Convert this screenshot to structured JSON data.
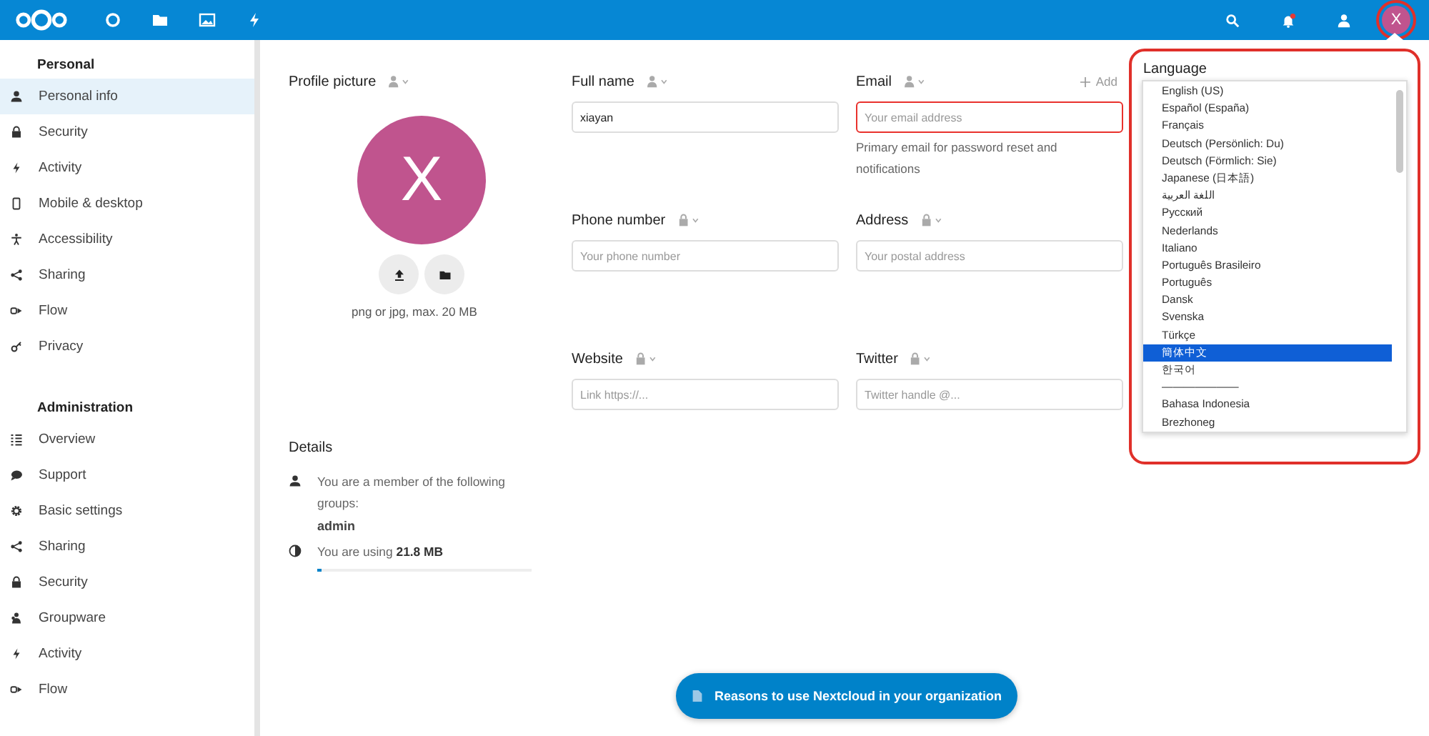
{
  "header": {
    "apps": [
      {
        "kind": "dashboard",
        "selected": false
      },
      {
        "kind": "files",
        "selected": false
      },
      {
        "kind": "photos",
        "selected": false
      },
      {
        "kind": "activity",
        "selected": false
      }
    ],
    "notifications": {
      "unread": true
    },
    "avatar": {
      "initial": "X",
      "color": "#c0548e"
    }
  },
  "sidebar": {
    "sections": [
      {
        "title": "Personal",
        "items": [
          {
            "label": "Personal info",
            "kind": "person",
            "selected": true
          },
          {
            "label": "Security",
            "kind": "lock",
            "selected": false
          },
          {
            "label": "Activity",
            "kind": "bolt",
            "selected": false
          },
          {
            "label": "Mobile & desktop",
            "kind": "phone",
            "selected": false
          },
          {
            "label": "Accessibility",
            "kind": "access",
            "selected": false
          },
          {
            "label": "Sharing",
            "kind": "share",
            "selected": false
          },
          {
            "label": "Flow",
            "kind": "flow",
            "selected": false
          },
          {
            "label": "Privacy",
            "kind": "key",
            "selected": false
          }
        ]
      },
      {
        "title": "Administration",
        "items": [
          {
            "label": "Overview",
            "kind": "list",
            "selected": false
          },
          {
            "label": "Support",
            "kind": "chat",
            "selected": false
          },
          {
            "label": "Basic settings",
            "kind": "gear",
            "selected": false
          },
          {
            "label": "Sharing",
            "kind": "share",
            "selected": false
          },
          {
            "label": "Security",
            "kind": "lock",
            "selected": false
          },
          {
            "label": "Groupware",
            "kind": "group",
            "selected": false
          },
          {
            "label": "Activity",
            "kind": "bolt",
            "selected": false
          },
          {
            "label": "Flow",
            "kind": "flow",
            "selected": false
          }
        ]
      }
    ]
  },
  "profile": {
    "label": "Profile picture",
    "private": false,
    "avatar": {
      "initial": "X",
      "color": "#c0548e"
    },
    "hint": "png or jpg, max. 20 MB"
  },
  "fields": [
    {
      "label": "Full name",
      "private": false,
      "value": "xiayan",
      "invalid": false
    },
    {
      "label": "Email",
      "private": false,
      "placeholder": "Your email address",
      "invalid": true,
      "add": "Add",
      "help": "Primary email for password reset and notifications"
    },
    {
      "label": "Phone number",
      "private": true,
      "placeholder": "Your phone number",
      "invalid": false
    },
    {
      "label": "Address",
      "private": true,
      "placeholder": "Your postal address",
      "invalid": false
    },
    {
      "label": "Website",
      "private": true,
      "placeholder": "Link https://...",
      "invalid": false
    },
    {
      "label": "Twitter",
      "private": true,
      "placeholder": "Twitter handle @...",
      "invalid": false
    }
  ],
  "details": {
    "title": "Details",
    "groups_text": "You are a member of the following groups:",
    "groups": [
      "admin"
    ],
    "usage_text": "You are using **21.8 MB**",
    "level": 0.02
  },
  "language": {
    "label": "Language",
    "highlighted": true,
    "options": [
      {
        "label": "English (US)",
        "selected": false
      },
      {
        "label": "Español (España)",
        "selected": false
      },
      {
        "label": "Français",
        "selected": false
      },
      {
        "label": "Deutsch (Persönlich: Du)",
        "selected": false
      },
      {
        "label": "Deutsch (Förmlich: Sie)",
        "selected": false
      },
      {
        "label": "Japanese (日本語)",
        "selected": false
      },
      {
        "label": "اللغة العربية",
        "selected": false
      },
      {
        "label": "Русский",
        "selected": false
      },
      {
        "label": "Nederlands",
        "selected": false
      },
      {
        "label": "Italiano",
        "selected": false
      },
      {
        "label": "Português Brasileiro",
        "selected": false
      },
      {
        "label": "Português",
        "selected": false
      },
      {
        "label": "Dansk",
        "selected": false
      },
      {
        "label": "Svenska",
        "selected": false
      },
      {
        "label": "Türkçe",
        "selected": false
      },
      {
        "label": "簡体中文",
        "selected": true
      },
      {
        "label": "한국어",
        "selected": false
      },
      {
        "label": "———————",
        "selected": false
      },
      {
        "label": "Bahasa Indonesia",
        "selected": false
      },
      {
        "label": "Brezhoneg",
        "selected": false
      }
    ]
  },
  "promo": {
    "label": "Reasons to use Nextcloud in your organization"
  }
}
